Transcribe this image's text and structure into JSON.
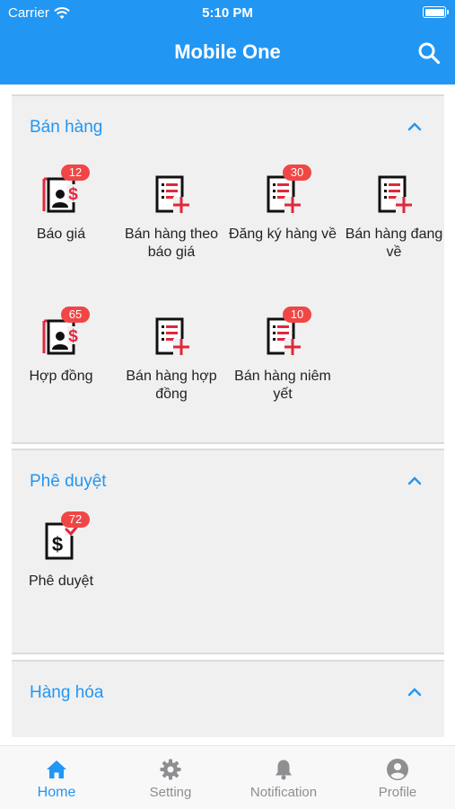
{
  "status_bar": {
    "carrier": "Carrier",
    "time": "5:10 PM"
  },
  "header": {
    "title": "Mobile One"
  },
  "colors": {
    "primary": "#2296f3",
    "badge": "#f04646",
    "icon_red": "#e0283c"
  },
  "sections": [
    {
      "title": "Bán hàng",
      "items": [
        {
          "label": "Báo giá",
          "badge": "12",
          "icon": "quote-document-icon"
        },
        {
          "label": "Bán hàng theo báo giá",
          "badge": "",
          "icon": "add-document-icon"
        },
        {
          "label": "Đăng ký hàng về",
          "badge": "30",
          "icon": "add-document-icon"
        },
        {
          "label": "Bán hàng đang về",
          "badge": "",
          "icon": "add-document-icon"
        },
        {
          "label": "Hợp đồng",
          "badge": "65",
          "icon": "contract-document-icon"
        },
        {
          "label": "Bán hàng hợp đồng",
          "badge": "",
          "icon": "add-document-icon"
        },
        {
          "label": "Bán hàng niêm yết",
          "badge": "10",
          "icon": "add-document-icon"
        }
      ]
    },
    {
      "title": "Phê duyệt",
      "items": [
        {
          "label": "Phê duyệt",
          "badge": "72",
          "icon": "approval-document-icon"
        }
      ]
    },
    {
      "title": "Hàng hóa",
      "items": []
    }
  ],
  "tabbar": [
    {
      "label": "Home",
      "icon": "home-icon",
      "active": true
    },
    {
      "label": "Setting",
      "icon": "gear-icon",
      "active": false
    },
    {
      "label": "Notification",
      "icon": "bell-icon",
      "active": false
    },
    {
      "label": "Profile",
      "icon": "profile-icon",
      "active": false
    }
  ]
}
